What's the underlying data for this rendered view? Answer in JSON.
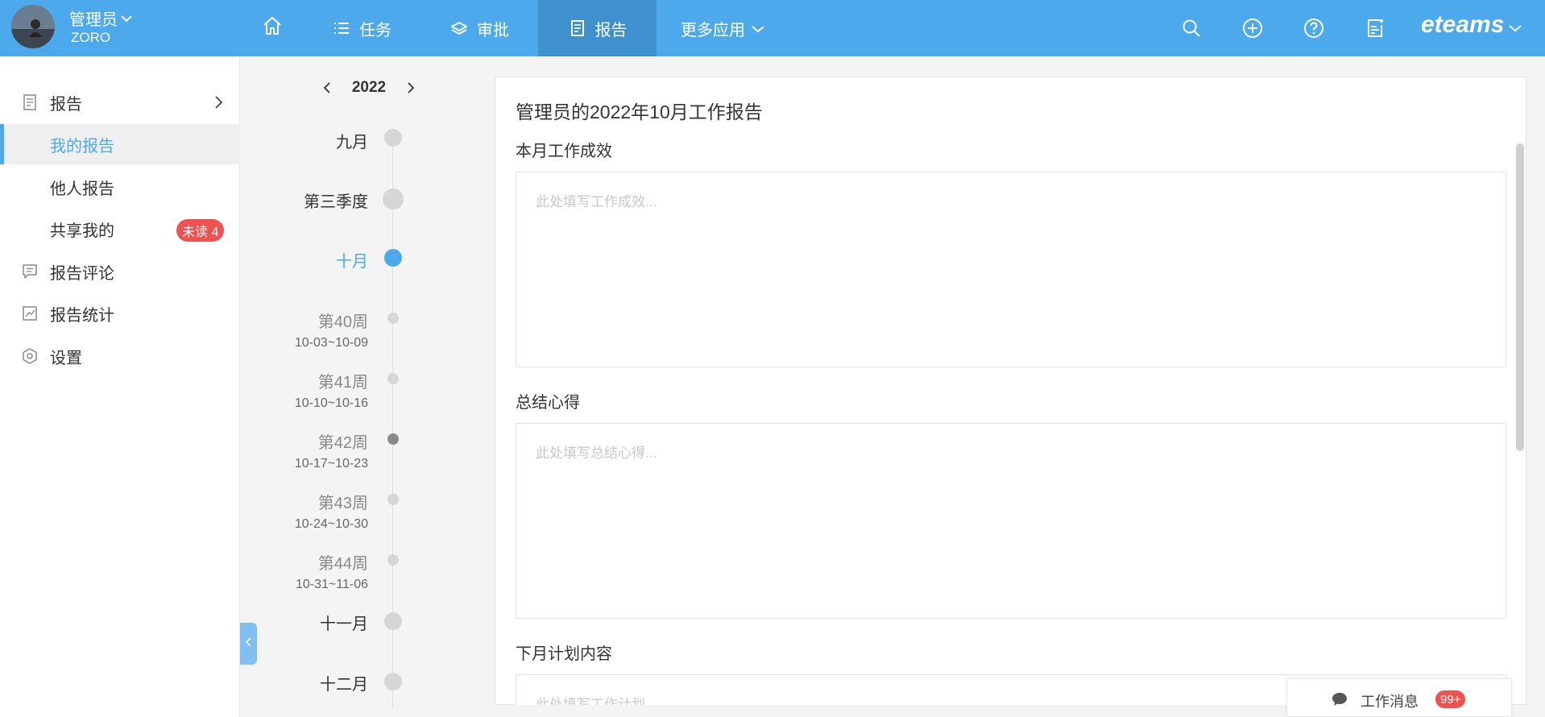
{
  "user": {
    "name": "管理员",
    "sub": "ZORO"
  },
  "nav": {
    "task": "任务",
    "approve": "审批",
    "report": "报告",
    "more": "更多应用"
  },
  "brand": "eteams",
  "sidebar": {
    "items": [
      {
        "label": "报告"
      },
      {
        "label": "我的报告"
      },
      {
        "label": "他人报告"
      },
      {
        "label": "共享我的",
        "badge": "未读 4"
      },
      {
        "label": "报告评论"
      },
      {
        "label": "报告统计"
      },
      {
        "label": "设置"
      }
    ]
  },
  "timeline": {
    "year": "2022",
    "entries": [
      {
        "label": "九月"
      },
      {
        "label": "第三季度"
      },
      {
        "label": "十月"
      },
      {
        "label": "第40周",
        "range": "10-03~10-09"
      },
      {
        "label": "第41周",
        "range": "10-10~10-16"
      },
      {
        "label": "第42周",
        "range": "10-17~10-23"
      },
      {
        "label": "第43周",
        "range": "10-24~10-30"
      },
      {
        "label": "第44周",
        "range": "10-31~11-06"
      },
      {
        "label": "十一月"
      },
      {
        "label": "十二月"
      }
    ]
  },
  "report": {
    "title": "管理员的2022年10月工作报告",
    "sections": [
      {
        "label": "本月工作成效",
        "placeholder": "此处填写工作成效..."
      },
      {
        "label": "总结心得",
        "placeholder": "此处填写总结心得..."
      },
      {
        "label": "下月计划内容",
        "placeholder": "此处填写工作计划..."
      }
    ]
  },
  "messages": {
    "label": "工作消息",
    "count": "99+"
  },
  "colors": {
    "accent": "#4ba9ec",
    "active_nav": "#3e90cf",
    "badge": "#f0524f"
  }
}
